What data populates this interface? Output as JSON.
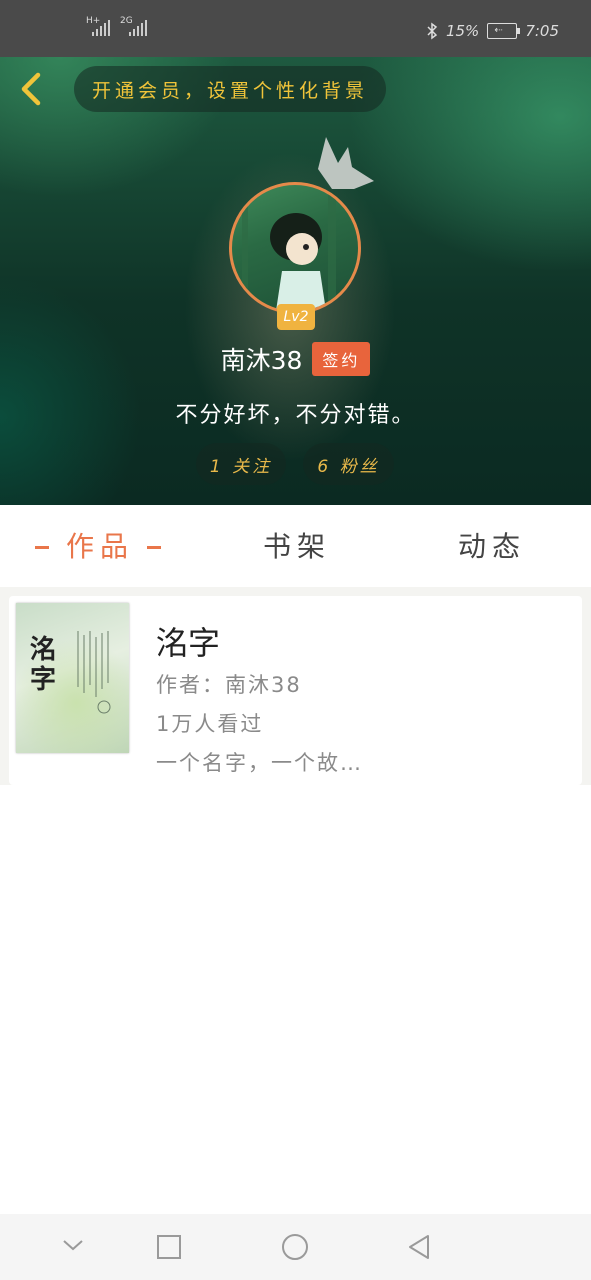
{
  "status_bar": {
    "signal1_label": "H+",
    "signal2_label": "2G",
    "battery_percent": "15%",
    "time": "7:05"
  },
  "header": {
    "vip_promo": "开通会员，设置个性化背景",
    "level_badge": "Lv2",
    "username": "南沐38",
    "signed_badge": "签约",
    "bio": "不分好坏，不分对错。",
    "following": "1 关注",
    "followers": "6 粉丝"
  },
  "tabs": [
    {
      "label": "作品",
      "active": true
    },
    {
      "label": "书架",
      "active": false
    },
    {
      "label": "动态",
      "active": false
    }
  ],
  "book": {
    "title": "洺字",
    "author_line": "作者：南沐38",
    "views_line": "1万人看过",
    "summary": "一个名字，一个故…",
    "cover_text": "洺字"
  },
  "colors": {
    "accent": "#e9764a",
    "signed_badge": "#e8643c",
    "level_badge": "#f0b340",
    "promo_text": "#f0c43a"
  },
  "icons": [
    "back-chevron-icon",
    "crown-icon",
    "bluetooth-icon",
    "battery-icon",
    "nav-collapse-icon",
    "nav-recent-icon",
    "nav-home-icon",
    "nav-back-icon"
  ]
}
